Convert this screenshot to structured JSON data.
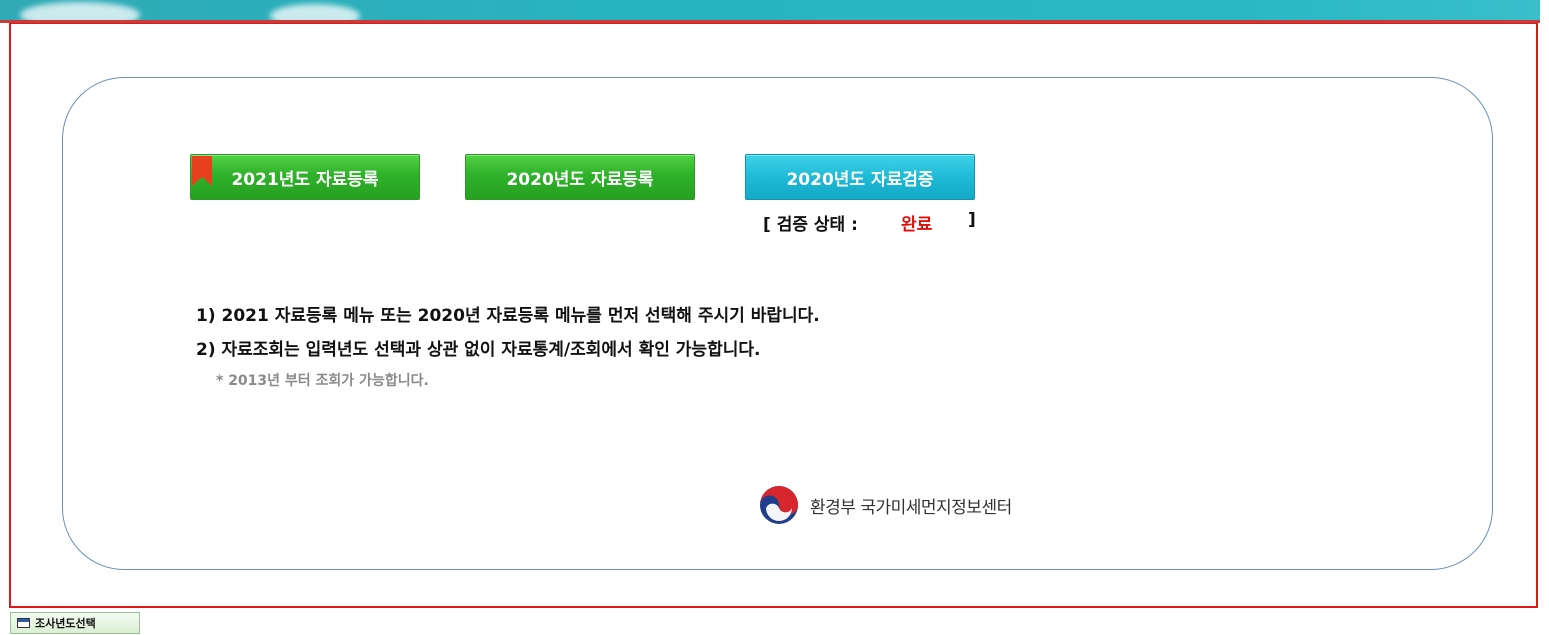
{
  "buttons": {
    "register_2021": "2021년도 자료등록",
    "register_2020": "2020년도 자료등록",
    "verify_2020": "2020년도 자료검증"
  },
  "verification": {
    "label": "[ 검증 상태 :",
    "value": "완료",
    "close": "]"
  },
  "notes": [
    "1) 2021 자료등록 메뉴 또는 2020년 자료등록 메뉴를 먼저 선택해 주시기 바랍니다.",
    "2) 자료조회는 입력년도 선택과 상관 없이 자료통계/조회에서 확인 가능합니다."
  ],
  "sub_note": "* 2013년 부터 조회가 가능합니다.",
  "logo": {
    "text": "환경부 국가미세먼지정보센터",
    "icon": "taegeuk-emblem-icon"
  },
  "taskbar": {
    "label": "조사년도선택",
    "icon": "window-icon"
  },
  "colors": {
    "green_button": "#2fb22a",
    "cyan_button": "#1ebad6",
    "status_complete": "#e01010",
    "frame_border": "#e01818",
    "banner": "#28b4c0"
  }
}
